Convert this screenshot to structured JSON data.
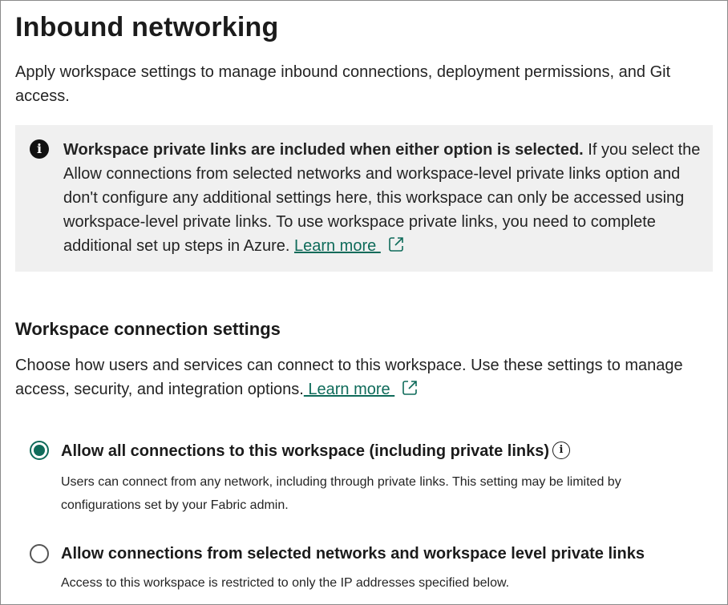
{
  "page": {
    "title": "Inbound networking",
    "description": "Apply workspace settings to manage inbound connections, deployment permissions, and Git access."
  },
  "info_banner": {
    "icon": "info-icon",
    "bold_text": "Workspace private links are included when either option is selected.",
    "body_text": " If you select the Allow connections from selected networks and workspace-level private links option and don't configure any additional settings here, this workspace can only be accessed using workspace-level private links. To use workspace private links, you need to complete additional set up steps in Azure. ",
    "link_label": "Learn more "
  },
  "connection_settings": {
    "title": "Workspace connection settings",
    "description": "Choose how users and services can connect to this workspace. Use these settings to manage access, security, and integration options.",
    "link_label": " Learn more ",
    "options": [
      {
        "label": "Allow all connections to this workspace (including private links)",
        "description": "Users can connect from any network, including through private links. This setting may be limited by configurations set by your Fabric admin.",
        "selected": true
      },
      {
        "label": "Allow connections from selected networks and workspace level private links",
        "description": "Access to this workspace is restricted to only the IP addresses specified below.",
        "selected": false
      }
    ]
  },
  "colors": {
    "accent": "#0f6b5a",
    "banner_background": "#f0f0f0",
    "text": "#242424"
  }
}
